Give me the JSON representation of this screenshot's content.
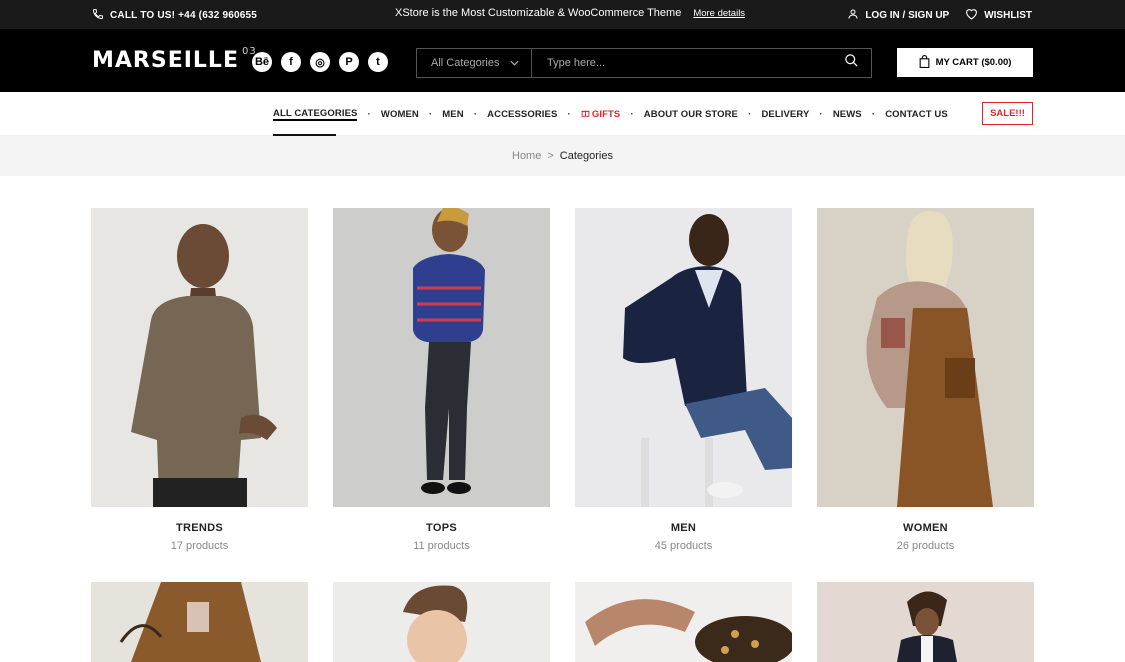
{
  "topbar": {
    "phone": "CALL TO US! +44 (632 960655",
    "promo": "XStore is the Most Customizable & WooCommerce Theme",
    "more_details": "More details",
    "login": "LOG IN / SIGN UP",
    "wishlist": "WISHLIST"
  },
  "header": {
    "logo": "MARSEILLE",
    "logo_sup": "03",
    "socials": [
      "Bē",
      "f",
      "◎",
      "P",
      "t"
    ],
    "search_category": "All Categories",
    "search_placeholder": "Type here...",
    "cart": "MY CART ($0.00)"
  },
  "nav": {
    "items": [
      "ALL CATEGORIES",
      "WOMEN",
      "MEN",
      "ACCESSORIES",
      "GIFTS",
      "ABOUT OUR STORE",
      "DELIVERY",
      "NEWS",
      "CONTACT US"
    ],
    "sale": "SALE!!!"
  },
  "breadcrumb": {
    "home": "Home",
    "separator": ">",
    "current": "Categories"
  },
  "categories": [
    {
      "title": "TRENDS",
      "count": "17 products",
      "bg": "#e8e6e3"
    },
    {
      "title": "TOPS",
      "count": "11 products",
      "bg": "#cdcdcb"
    },
    {
      "title": "MEN",
      "count": "45 products",
      "bg": "#e9e9eb"
    },
    {
      "title": "WOMEN",
      "count": "26 products",
      "bg": "#d8d1c6"
    }
  ],
  "colors": {
    "accent_red": "#e0242b",
    "topbar_bg": "#1a1a1a",
    "header_bg": "#000000"
  }
}
